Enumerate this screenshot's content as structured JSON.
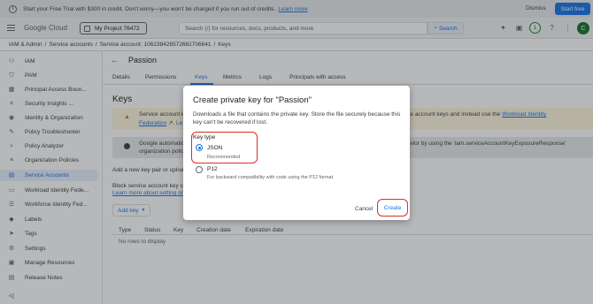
{
  "banner": {
    "text": "Start your Free Trial with $300 in credit. Don't worry—you won't be charged if you run out of credits.",
    "learn_more": "Learn more",
    "dismiss": "Dismiss",
    "start_free": "Start free"
  },
  "header": {
    "logo": "Google Cloud",
    "project": "My Project 76472",
    "search_placeholder": "Search (/) for resources, docs, products, and more",
    "search_button": "Search",
    "notifications_count": "1",
    "avatar_letter": "C"
  },
  "breadcrumb": [
    "IAM & Admin",
    "Service accounts",
    "Service account: 106238426572682706641",
    "Keys"
  ],
  "sidebar": {
    "items": [
      {
        "label": "IAM",
        "icon": "person-add-icon"
      },
      {
        "label": "PAM",
        "icon": "shield-icon"
      },
      {
        "label": "Principal Access Boun...",
        "icon": "grid-icon"
      },
      {
        "label": "Security Insights ...",
        "icon": "insights-icon"
      },
      {
        "label": "Identity & Organization",
        "icon": "org-icon"
      },
      {
        "label": "Policy Troubleshooter",
        "icon": "wrench-icon"
      },
      {
        "label": "Policy Analyzer",
        "icon": "analyzer-icon"
      },
      {
        "label": "Organization Policies",
        "icon": "list-icon"
      },
      {
        "label": "Service Accounts",
        "icon": "service-account-icon"
      },
      {
        "label": "Workload Identity Fede...",
        "icon": "workload-icon"
      },
      {
        "label": "Workforce Identity Fed...",
        "icon": "workforce-icon"
      },
      {
        "label": "Labels",
        "icon": "label-icon"
      },
      {
        "label": "Tags",
        "icon": "tag-icon"
      },
      {
        "label": "Settings",
        "icon": "settings-icon"
      },
      {
        "label": "Manage Resources",
        "icon": "resources-icon"
      },
      {
        "label": "Release Notes",
        "icon": "notes-icon"
      }
    ]
  },
  "main": {
    "title": "Passion",
    "tabs": [
      "Details",
      "Permissions",
      "Keys",
      "Metrics",
      "Logs",
      "Principals with access"
    ],
    "keys_heading": "Keys",
    "warning_line1": "Service account k",
    "warning_line2": "Federation",
    "warning_line2b": "Le",
    "warning_right": "e service account keys and instead use the",
    "warning_link": "Workload Identity",
    "info_line1": "Google automatic",
    "info_line2": "organization polic",
    "info_right": "behavior by using the 'iam.serviceAccountKeyExposureResponse'",
    "add_new": "Add a new key pair or uploa",
    "block_line1": "Block service account key cr",
    "block_line2": "Learn more about setting or",
    "add_key": "Add key",
    "table_headers": [
      "Type",
      "Status",
      "Key",
      "Creation date",
      "Expiration date"
    ],
    "no_rows": "No rows to display"
  },
  "dialog": {
    "title": "Create private key for \"Passion\"",
    "description": "Downloads a file that contains the private key. Store the file securely because this key can't be recovered if lost.",
    "key_type_label": "Key type",
    "options": [
      {
        "label": "JSON",
        "sub": "Recommended",
        "checked": true
      },
      {
        "label": "P12",
        "sub": "For backward compatibility with code using the P12 format",
        "checked": false
      }
    ],
    "cancel": "Cancel",
    "create": "Create"
  },
  "colors": {
    "accent": "#1a73e8",
    "highlight": "#d93025",
    "warning_bg": "#fef7e0",
    "active_nav_bg": "#e8f0fe"
  }
}
